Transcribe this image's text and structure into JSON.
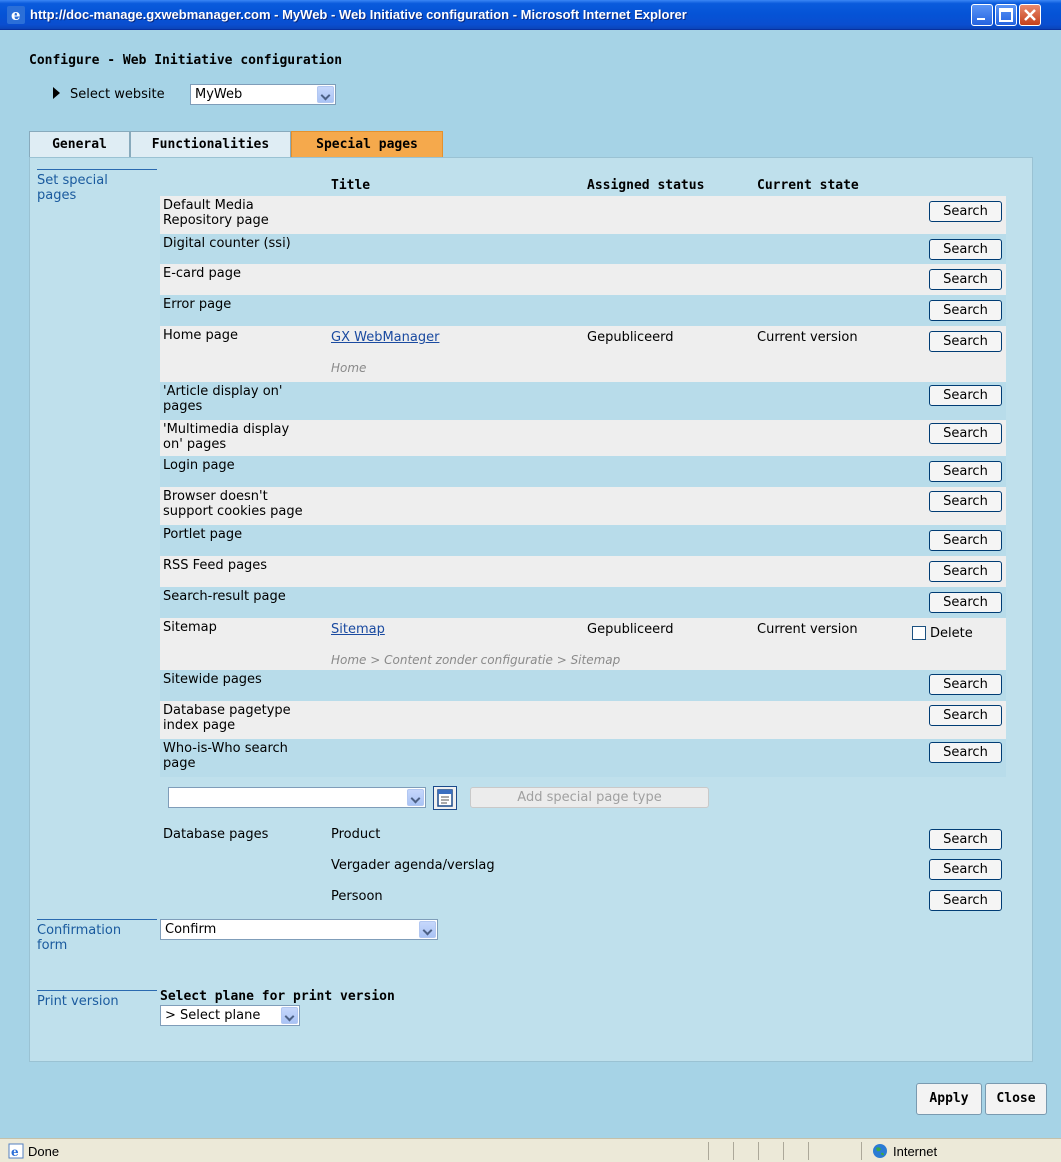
{
  "window": {
    "title": "http://doc-manage.gxwebmanager.com - MyWeb - Web Initiative configuration - Microsoft Internet Explorer"
  },
  "header": {
    "title": "Configure - Web Initiative configuration",
    "select_website_label": "Select website",
    "website_value": "MyWeb"
  },
  "tabs": [
    {
      "label": "General",
      "active": false
    },
    {
      "label": "Functionalities",
      "active": false
    },
    {
      "label": "Special pages",
      "active": true
    }
  ],
  "special_pages": {
    "section_label": "Set special pages",
    "columns": {
      "title": "Title",
      "assigned_status": "Assigned status",
      "current_state": "Current state"
    },
    "rows": [
      {
        "name": "Default Media Repository page",
        "action": "Search"
      },
      {
        "name": "Digital counter (ssi)",
        "action": "Search"
      },
      {
        "name": "E-card page",
        "action": "Search"
      },
      {
        "name": "Error page",
        "action": "Search"
      },
      {
        "name": "Home page",
        "title": "GX WebManager",
        "status": "Gepubliceerd",
        "state": "Current version",
        "path": "Home",
        "action": "Search"
      },
      {
        "name": "'Article display on' pages",
        "action": "Search"
      },
      {
        "name": "'Multimedia display on' pages",
        "action": "Search"
      },
      {
        "name": "Login page",
        "action": "Search"
      },
      {
        "name": "Browser doesn't support cookies page",
        "action": "Search"
      },
      {
        "name": "Portlet page",
        "action": "Search"
      },
      {
        "name": "RSS Feed pages",
        "action": "Search"
      },
      {
        "name": "Search-result page",
        "action": "Search"
      },
      {
        "name": "Sitemap",
        "title": "Sitemap",
        "status": "Gepubliceerd",
        "state": "Current version",
        "path": "Home > Content zonder configuratie > Sitemap",
        "delete_label": "Delete"
      },
      {
        "name": "Sitewide pages",
        "action": "Search"
      },
      {
        "name": "Database pagetype index page",
        "action": "Search"
      },
      {
        "name": "Who-is-Who search page",
        "action": "Search"
      }
    ],
    "add_special_page_type": "Add special page type",
    "add_select_value": ""
  },
  "database_pages": {
    "label": "Database pages",
    "items": [
      {
        "name": "Product",
        "action": "Search"
      },
      {
        "name": "Vergader agenda/verslag",
        "action": "Search"
      },
      {
        "name": "Persoon",
        "action": "Search"
      }
    ]
  },
  "confirmation": {
    "section_label": "Confirmation form",
    "value": "Confirm"
  },
  "print_version": {
    "section_label": "Print version",
    "heading": "Select plane for print version",
    "value": "> Select plane"
  },
  "actions": {
    "apply": "Apply",
    "close": "Close"
  },
  "statusbar": {
    "status": "Done",
    "zone": "Internet"
  }
}
